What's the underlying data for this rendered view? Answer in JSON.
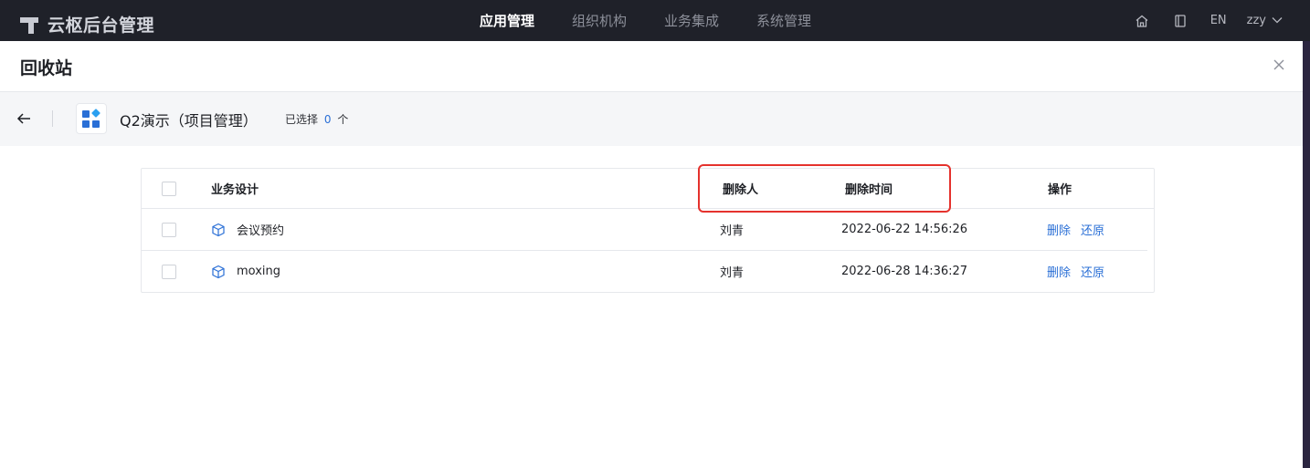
{
  "topbar": {
    "app_title": "云枢后台管理",
    "nav": [
      {
        "label": "应用管理",
        "active": true
      },
      {
        "label": "组织机构",
        "active": false
      },
      {
        "label": "业务集成",
        "active": false
      },
      {
        "label": "系统管理",
        "active": false
      }
    ],
    "lang": "EN",
    "user": "zzy"
  },
  "panel": {
    "title": "回收站"
  },
  "subbar": {
    "app_name": "Q2演示（项目管理）",
    "selected_prefix": "已选择",
    "selected_count": "0",
    "selected_suffix": "个"
  },
  "table": {
    "headers": {
      "name": "业务设计",
      "deleter": "删除人",
      "deleted_at": "删除时间",
      "actions": "操作"
    },
    "rows": [
      {
        "name": "会议预约",
        "deleter": "刘青",
        "deleted_at": "2022-06-22 14:56:26",
        "delete_label": "删除",
        "restore_label": "还原"
      },
      {
        "name": "moxing",
        "deleter": "刘青",
        "deleted_at": "2022-06-28 14:36:27",
        "delete_label": "删除",
        "restore_label": "还原"
      }
    ]
  },
  "colors": {
    "accent": "#2a6fd6",
    "highlight": "#e5322d",
    "topbar_bg": "#1f2129"
  },
  "icons": {
    "home": "home-icon",
    "book": "book-icon",
    "close": "close-icon",
    "back": "arrow-left-icon",
    "app": "app-grid-icon",
    "row": "cube-icon"
  }
}
